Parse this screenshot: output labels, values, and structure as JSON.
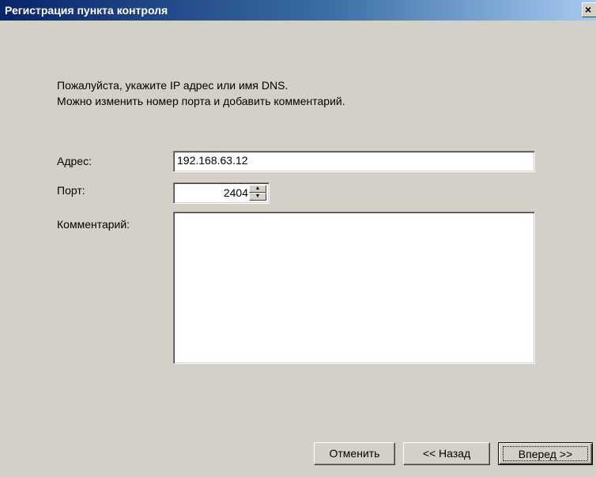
{
  "window": {
    "title": "Регистрация пункта контроля",
    "close_glyph": "×"
  },
  "instructions": {
    "line1": "Пожалуйста, укажите IP адрес или имя DNS.",
    "line2": "Можно изменить номер порта и добавить комментарий."
  },
  "form": {
    "address_label": "Адрес:",
    "address_value": "192.168.63.12",
    "port_label": "Порт:",
    "port_value": "2404",
    "comment_label": "Комментарий:",
    "comment_value": ""
  },
  "buttons": {
    "cancel": "Отменить",
    "back": "<< Назад",
    "next": "Вперед >>"
  },
  "icons": {
    "close": "close-icon",
    "spin_up": "spin-up-icon",
    "spin_down": "spin-down-icon"
  }
}
